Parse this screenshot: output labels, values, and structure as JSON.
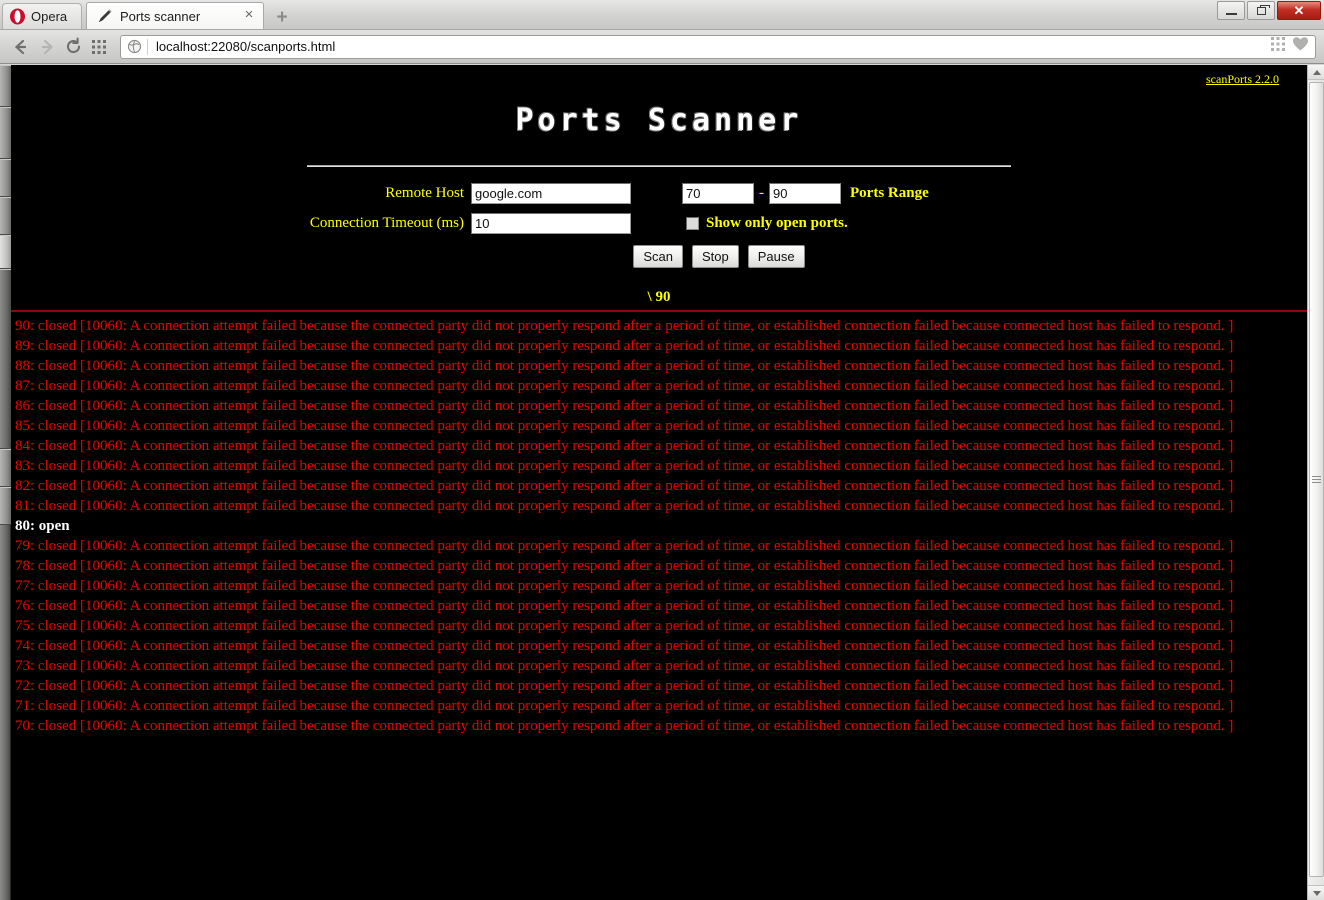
{
  "browser": {
    "opera_menu_label": "Opera",
    "tab": {
      "title": "Ports scanner",
      "favicon": "pencil-icon",
      "close_glyph": "×"
    },
    "new_tab_glyph": "+",
    "nav": {
      "back": "←",
      "forward": "→",
      "reload": "↻",
      "speeddial": "speed-dial-icon"
    },
    "url": "localhost:22080/scanports.html",
    "url_badge": "globe-icon",
    "url_right_icons": [
      "grid-icon",
      "heart-icon"
    ],
    "window_buttons": {
      "minimize": "minimize-icon",
      "maximize": "restore-icon",
      "close": "✕"
    }
  },
  "page": {
    "version_link": "scanPorts 2.2.0",
    "title": "Ports Scanner",
    "form": {
      "remote_host_label": "Remote Host",
      "remote_host_value": "google.com",
      "remote_host_placeholder": "",
      "timeout_label": "Connection Timeout (ms)",
      "timeout_value": "10",
      "timeout_placeholder": "",
      "port_from_value": "70",
      "port_from_placeholder": "",
      "port_to_value": "90",
      "port_to_placeholder": "",
      "range_dash": "-",
      "ports_range_label": "Ports Range",
      "show_open_only_label": "Show only open ports.",
      "show_open_only_checked": false,
      "scan_button": "Scan",
      "stop_button": "Stop",
      "pause_button": "Pause"
    },
    "progress_text": "\\ 90",
    "colors": {
      "background": "#000000",
      "label": "#ffff00",
      "closed": "#ee0000",
      "open": "#ffffff",
      "rule": "#990000"
    },
    "log": [
      {
        "port": "90",
        "status": "closed",
        "text": "90: closed [10060: A connection attempt failed because the connected party did not properly respond after a period of time, or established connection failed because connected host has failed to respond. ]"
      },
      {
        "port": "89",
        "status": "closed",
        "text": "89: closed [10060: A connection attempt failed because the connected party did not properly respond after a period of time, or established connection failed because connected host has failed to respond. ]"
      },
      {
        "port": "88",
        "status": "closed",
        "text": "88: closed [10060: A connection attempt failed because the connected party did not properly respond after a period of time, or established connection failed because connected host has failed to respond. ]"
      },
      {
        "port": "87",
        "status": "closed",
        "text": "87: closed [10060: A connection attempt failed because the connected party did not properly respond after a period of time, or established connection failed because connected host has failed to respond. ]"
      },
      {
        "port": "86",
        "status": "closed",
        "text": "86: closed [10060: A connection attempt failed because the connected party did not properly respond after a period of time, or established connection failed because connected host has failed to respond. ]"
      },
      {
        "port": "85",
        "status": "closed",
        "text": "85: closed [10060: A connection attempt failed because the connected party did not properly respond after a period of time, or established connection failed because connected host has failed to respond. ]"
      },
      {
        "port": "84",
        "status": "closed",
        "text": "84: closed [10060: A connection attempt failed because the connected party did not properly respond after a period of time, or established connection failed because connected host has failed to respond. ]"
      },
      {
        "port": "83",
        "status": "closed",
        "text": "83: closed [10060: A connection attempt failed because the connected party did not properly respond after a period of time, or established connection failed because connected host has failed to respond. ]"
      },
      {
        "port": "82",
        "status": "closed",
        "text": "82: closed [10060: A connection attempt failed because the connected party did not properly respond after a period of time, or established connection failed because connected host has failed to respond. ]"
      },
      {
        "port": "81",
        "status": "closed",
        "text": "81: closed [10060: A connection attempt failed because the connected party did not properly respond after a period of time, or established connection failed because connected host has failed to respond. ]"
      },
      {
        "port": "80",
        "status": "open",
        "text": "80: open"
      },
      {
        "port": "79",
        "status": "closed",
        "text": "79: closed [10060: A connection attempt failed because the connected party did not properly respond after a period of time, or established connection failed because connected host has failed to respond. ]"
      },
      {
        "port": "78",
        "status": "closed",
        "text": "78: closed [10060: A connection attempt failed because the connected party did not properly respond after a period of time, or established connection failed because connected host has failed to respond. ]"
      },
      {
        "port": "77",
        "status": "closed",
        "text": "77: closed [10060: A connection attempt failed because the connected party did not properly respond after a period of time, or established connection failed because connected host has failed to respond. ]"
      },
      {
        "port": "76",
        "status": "closed",
        "text": "76: closed [10060: A connection attempt failed because the connected party did not properly respond after a period of time, or established connection failed because connected host has failed to respond. ]"
      },
      {
        "port": "75",
        "status": "closed",
        "text": "75: closed [10060: A connection attempt failed because the connected party did not properly respond after a period of time, or established connection failed because connected host has failed to respond. ]"
      },
      {
        "port": "74",
        "status": "closed",
        "text": "74: closed [10060: A connection attempt failed because the connected party did not properly respond after a period of time, or established connection failed because connected host has failed to respond. ]"
      },
      {
        "port": "73",
        "status": "closed",
        "text": "73: closed [10060: A connection attempt failed because the connected party did not properly respond after a period of time, or established connection failed because connected host has failed to respond. ]"
      },
      {
        "port": "72",
        "status": "closed",
        "text": "72: closed [10060: A connection attempt failed because the connected party did not properly respond after a period of time, or established connection failed because connected host has failed to respond. ]"
      },
      {
        "port": "71",
        "status": "closed",
        "text": "71: closed [10060: A connection attempt failed because the connected party did not properly respond after a period of time, or established connection failed because connected host has failed to respond. ]"
      },
      {
        "port": "70",
        "status": "closed",
        "text": "70: closed [10060: A connection attempt failed because the connected party did not properly respond after a period of time, or established connection failed because connected host has failed to respond. ]"
      }
    ]
  }
}
